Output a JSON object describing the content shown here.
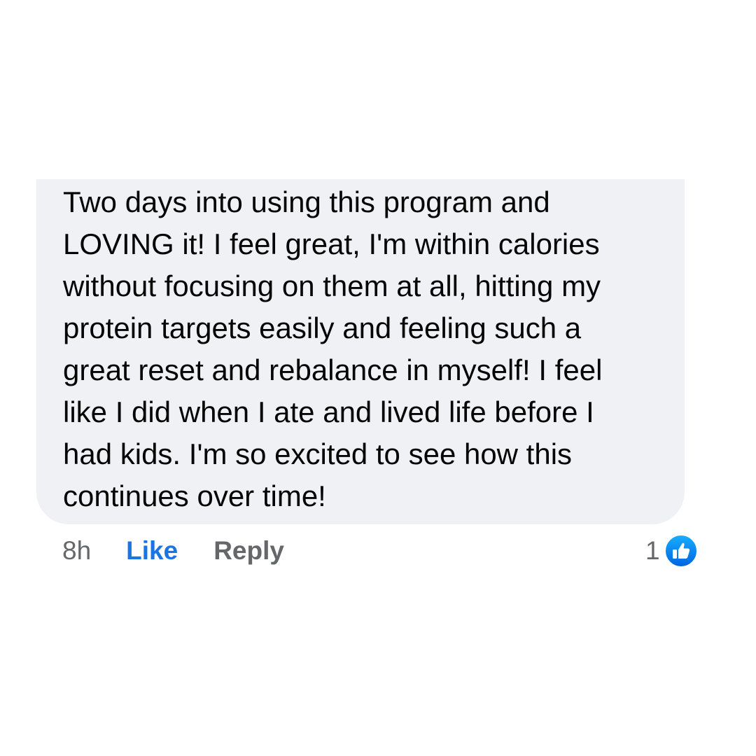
{
  "comment": {
    "lines": [
      "Two days into using this program and",
      "LOVING it! I feel great, I'm within calories",
      "without focusing on them at all, hitting my",
      "protein targets easily and feeling such a",
      "great reset and rebalance in myself! I feel",
      "like I did when I ate and lived life before I",
      "had kids. I'm so excited to see how this",
      "continues over time!"
    ]
  },
  "actions": {
    "timestamp": "8h",
    "like_label": "Like",
    "reply_label": "Reply"
  },
  "reactions": {
    "count": "1",
    "icon": "thumbs-up-icon",
    "badge_color": "#1877f2"
  },
  "colors": {
    "bubble_background": "#f0f1f5",
    "like_active": "#1b74e4",
    "secondary_text": "#65676b"
  }
}
